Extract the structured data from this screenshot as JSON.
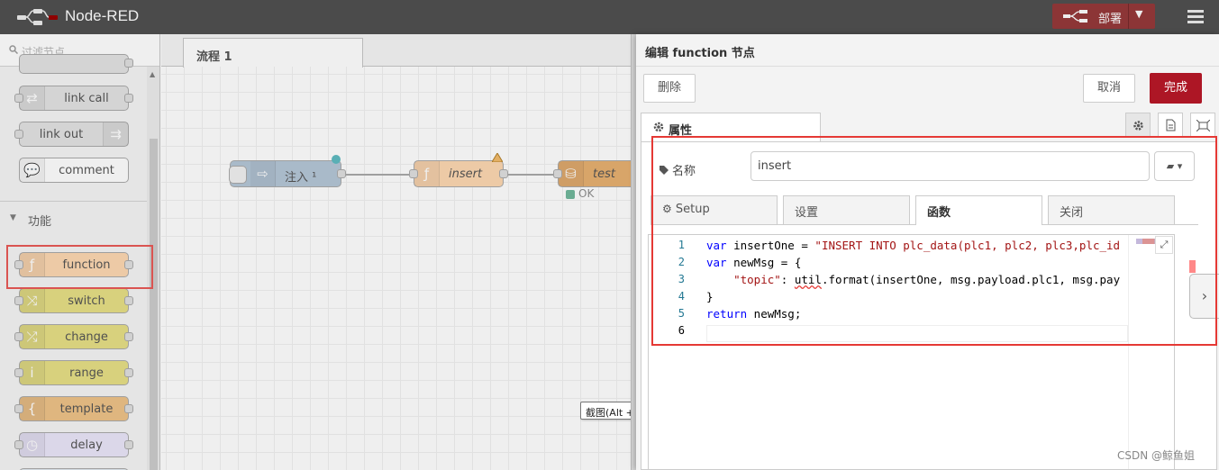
{
  "app": {
    "title": "Node-RED"
  },
  "header": {
    "deploy_label": "部署"
  },
  "palette": {
    "search_placeholder": "过滤节点",
    "nodes_top": [
      {
        "label": "link call",
        "color": "#dddddd"
      },
      {
        "label": "link out",
        "color": "#dddddd"
      },
      {
        "label": "comment",
        "color": "#ffffff"
      }
    ],
    "category_function": "功能",
    "function_nodes": [
      {
        "label": "function",
        "color": "#fdd0a2",
        "icon": "ƒ"
      },
      {
        "label": "switch",
        "color": "#e2d96e",
        "icon": "⤨"
      },
      {
        "label": "change",
        "color": "#e2d96e",
        "icon": "⤮"
      },
      {
        "label": "range",
        "color": "#e2d96e",
        "icon": "i"
      },
      {
        "label": "template",
        "color": "#ebb670",
        "icon": "{"
      },
      {
        "label": "delay",
        "color": "#e6e0f8",
        "icon": "◷"
      }
    ]
  },
  "workspace": {
    "tab_label": "流程 1",
    "nodes": [
      {
        "label": "注入 ¹",
        "color": "#a6bbcf"
      },
      {
        "label": "insert",
        "color": "#fdd0a2"
      },
      {
        "label": "test",
        "color": "#e2a054"
      }
    ],
    "status_ok": "OK",
    "screenshot_tooltip": "截图(Alt + A)"
  },
  "tray": {
    "title": "编辑 function 节点",
    "delete_label": "删除",
    "cancel_label": "取消",
    "done_label": "完成",
    "properties_tab": "属性",
    "name_label": "名称",
    "name_value": "insert",
    "sub_tabs": [
      "Setup",
      "设置",
      "函数",
      "关闭"
    ],
    "active_sub_tab": "函数",
    "code_lines": [
      {
        "num": "1"
      },
      {
        "num": "2"
      },
      {
        "num": "3"
      },
      {
        "num": "4"
      },
      {
        "num": "5"
      },
      {
        "num": "6"
      }
    ]
  },
  "watermark": "CSDN @鲸鱼姐",
  "colors": {
    "header_bg": "#4b4b4b",
    "deploy_bg": "#8c3536",
    "done_button": "#ad1625",
    "highlight_box": "#e53935"
  }
}
